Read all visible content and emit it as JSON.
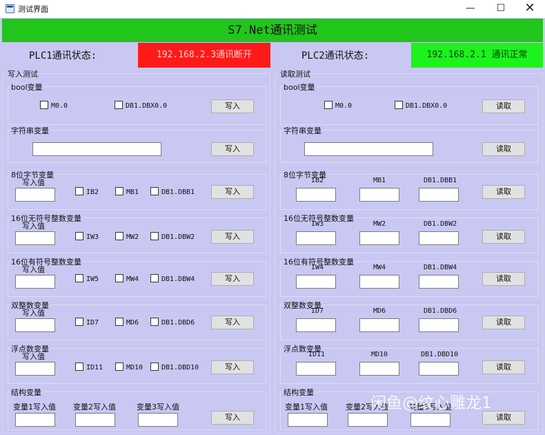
{
  "window": {
    "title": "测试界面",
    "minimize": "—",
    "maximize": "☐",
    "close": "✕"
  },
  "header": {
    "title": "S7.Net通讯测试",
    "color": "#22c51c"
  },
  "plc1": {
    "label": "PLC1通讯状态:",
    "status": "192.168.2.3通讯断开",
    "status_color": "#ff1a1a"
  },
  "plc2": {
    "label": "PLC2通讯状态:",
    "status": "192.168.2.1 通讯正常",
    "status_color": "#1cf21c"
  },
  "write": {
    "title": "写入测试",
    "button": "写入",
    "value_label": "写入值",
    "bool": {
      "title": "bool变量",
      "items": [
        "M0.0",
        "DB1.DBX0.0"
      ]
    },
    "string": {
      "title": "字符串变量"
    },
    "byte": {
      "title": "8位字节变量",
      "items": [
        "IB2",
        "MB1",
        "DB1.DBB1"
      ]
    },
    "uint16": {
      "title": "16位无符号整数变量",
      "items": [
        "IW3",
        "MW2",
        "DB1.DBW2"
      ]
    },
    "int16": {
      "title": "16位有符号整数变量",
      "items": [
        "IW5",
        "MW4",
        "DB1.DBW4"
      ]
    },
    "dint": {
      "title": "双整数变量",
      "items": [
        "ID7",
        "MD6",
        "DB1.DBD6"
      ]
    },
    "real": {
      "title": "浮点数变量",
      "items": [
        "ID11",
        "MD10",
        "DB1.DBD10"
      ]
    },
    "struct": {
      "title": "结构变量",
      "labels": [
        "变量1写入值",
        "变量2写入值",
        "变量3写入值"
      ]
    }
  },
  "read": {
    "title": "读取测试",
    "button": "读取",
    "bool": {
      "title": "bool变量",
      "items": [
        "M0.0",
        "DB1.DBX0.0"
      ]
    },
    "string": {
      "title": "字符串变量"
    },
    "byte": {
      "title": "8位字节变量",
      "items": [
        "IB2",
        "MB1",
        "DB1.DBB1"
      ]
    },
    "uint16": {
      "title": "16位无符号整数变量",
      "items": [
        "IW3",
        "MW2",
        "DB1.DBW2"
      ]
    },
    "int16": {
      "title": "16位有符号整数变量",
      "items": [
        "IW4",
        "MW4",
        "DB1.DBW4"
      ]
    },
    "dint": {
      "title": "双整数变量",
      "items": [
        "ID7",
        "MD6",
        "DB1.DBD6"
      ]
    },
    "real": {
      "title": "浮点数变量",
      "items": [
        "ID11",
        "MD10",
        "DB1.DBD10"
      ]
    },
    "struct": {
      "title": "结构变量",
      "labels": [
        "变量1写入值",
        "变量2写入值",
        "变量3写入值"
      ]
    }
  },
  "watermark": "闲鱼@纹心雕龙1"
}
